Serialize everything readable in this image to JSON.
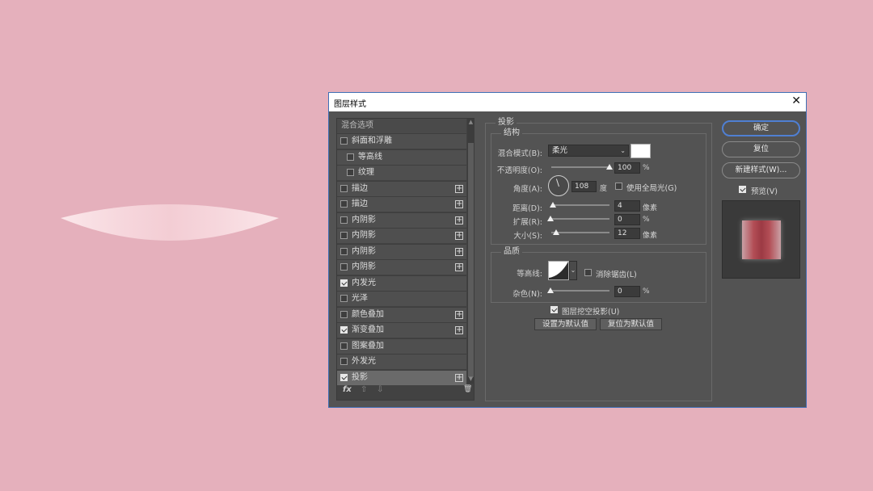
{
  "dialog": {
    "title": "图层样式",
    "close_glyph": "✕"
  },
  "styles_list": {
    "header": "混合选项",
    "items": [
      {
        "label": "斜面和浮雕",
        "checked": false,
        "indent": false,
        "plus": false
      },
      {
        "label": "等高线",
        "checked": false,
        "indent": true,
        "plus": false
      },
      {
        "label": "纹理",
        "checked": false,
        "indent": true,
        "plus": false
      },
      {
        "label": "描边",
        "checked": false,
        "indent": false,
        "plus": true
      },
      {
        "label": "描边",
        "checked": false,
        "indent": false,
        "plus": true
      },
      {
        "label": "内阴影",
        "checked": false,
        "indent": false,
        "plus": true
      },
      {
        "label": "内阴影",
        "checked": false,
        "indent": false,
        "plus": true
      },
      {
        "label": "内阴影",
        "checked": false,
        "indent": false,
        "plus": true
      },
      {
        "label": "内阴影",
        "checked": false,
        "indent": false,
        "plus": true
      },
      {
        "label": "内发光",
        "checked": true,
        "indent": false,
        "plus": false
      },
      {
        "label": "光泽",
        "checked": false,
        "indent": false,
        "plus": false
      },
      {
        "label": "颜色叠加",
        "checked": false,
        "indent": false,
        "plus": true
      },
      {
        "label": "渐变叠加",
        "checked": true,
        "indent": false,
        "plus": true
      },
      {
        "label": "图案叠加",
        "checked": false,
        "indent": false,
        "plus": false
      },
      {
        "label": "外发光",
        "checked": false,
        "indent": false,
        "plus": false
      },
      {
        "label": "投影",
        "checked": true,
        "indent": false,
        "plus": true,
        "selected": true
      }
    ],
    "plus_glyph": "+",
    "footer": {
      "fx": "fx",
      "up": "⇧",
      "down": "⇩",
      "trash": "🗑"
    }
  },
  "drop_shadow": {
    "title": "投影",
    "structure": {
      "title": "结构",
      "blend_mode_label": "混合模式(B):",
      "blend_mode_value": "柔光",
      "shadow_color": "#ffffff",
      "opacity_label": "不透明度(O):",
      "opacity_value": "100",
      "opacity_fraction": 1.0,
      "percent": "%",
      "angle_label": "角度(A):",
      "angle_value": "108",
      "angle_unit": "度",
      "global_light_label": "使用全局光(G)",
      "global_light_checked": false,
      "distance_label": "距离(D):",
      "distance_value": "4",
      "size_unit": "像素",
      "spread_label": "扩展(R):",
      "spread_value": "0",
      "size_label": "大小(S):",
      "size_value": "12"
    },
    "quality": {
      "title": "品质",
      "contour_label": "等高线:",
      "anti_alias_label": "消除锯齿(L)",
      "anti_alias_checked": false,
      "noise_label": "杂色(N):",
      "noise_value": "0",
      "percent": "%"
    },
    "knockout_label": "图层挖空投影(U)",
    "knockout_checked": true,
    "set_default_label": "设置为默认值",
    "reset_default_label": "复位为默认值"
  },
  "right_panel": {
    "ok_label": "确定",
    "reset_label": "复位",
    "new_style_label": "新建样式(W)...",
    "preview_label": "预览(V)",
    "preview_checked": true
  },
  "colors": {
    "canvas_background": "#e5b0bc",
    "dialog_background": "#535353",
    "accent": "#4f7fd2"
  }
}
